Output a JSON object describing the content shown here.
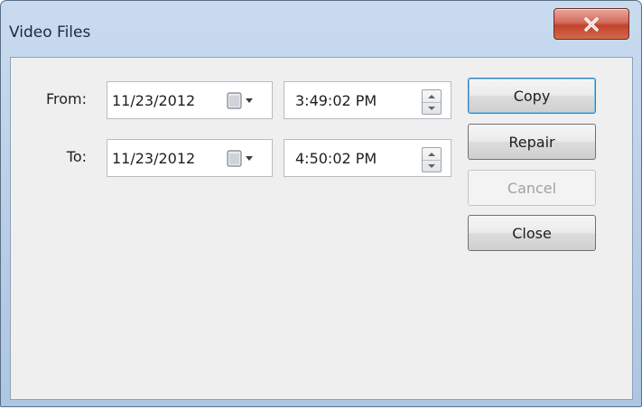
{
  "window": {
    "title": "Video Files"
  },
  "range": {
    "from": {
      "label": "From:",
      "date": "11/23/2012",
      "time": "3:49:02 PM"
    },
    "to": {
      "label": "To:",
      "date": "11/23/2012",
      "time": "4:50:02 PM"
    }
  },
  "buttons": {
    "copy": "Copy",
    "repair": "Repair",
    "cancel": "Cancel",
    "close": "Close"
  },
  "icons": {
    "close": "close-icon",
    "calendar": "calendar-icon",
    "dropdown": "chevron-down-icon",
    "spin_up": "spin-up-icon",
    "spin_down": "spin-down-icon"
  },
  "colors": {
    "title_bar": "#b8cde6",
    "close_button": "#c3422c",
    "client_bg": "#efefef",
    "default_button_border": "#3c7fb1"
  }
}
